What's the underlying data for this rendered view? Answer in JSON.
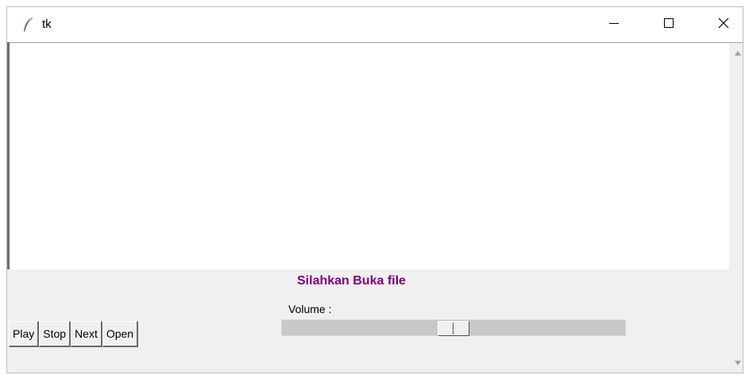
{
  "window": {
    "title": "tk",
    "icons": {
      "app": "feather-icon",
      "minimize": "minimize-icon",
      "maximize": "maximize-icon",
      "close": "close-icon"
    }
  },
  "status": {
    "text": "Silahkan Buka file",
    "color": "#800080"
  },
  "volume": {
    "label": "Volume :",
    "level": 0.5
  },
  "controls": {
    "play": "Play",
    "stop": "Stop",
    "next": "Next",
    "open": "Open"
  }
}
